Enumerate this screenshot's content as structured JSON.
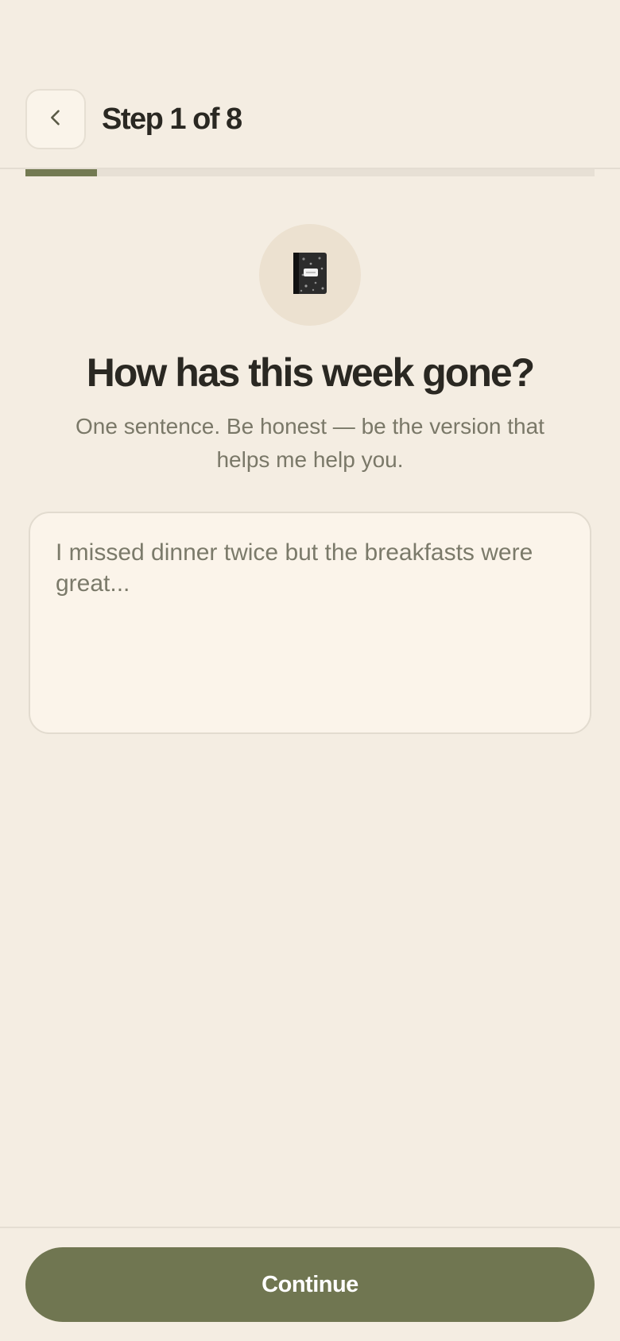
{
  "header": {
    "step_title": "Step 1 of 8",
    "back_icon": "chevron-left-icon"
  },
  "progress": {
    "current_step": 1,
    "total_steps": 8,
    "fraction": 0.125,
    "fill_color": "#737a52",
    "track_color": "#e7e0d5"
  },
  "prompt": {
    "emoji": "📓",
    "emoji_icon": "notebook-icon",
    "question": "How has this week gone?",
    "subtitle": "One sentence. Be honest — be the version that helps me help you."
  },
  "answer": {
    "value": "",
    "placeholder": "I missed dinner twice but the breakfasts were great..."
  },
  "footer": {
    "continue_label": "Continue",
    "button_color": "#707651"
  },
  "colors": {
    "background": "#f4ede2",
    "text_primary": "#2a2822",
    "text_muted": "#7a7868"
  }
}
